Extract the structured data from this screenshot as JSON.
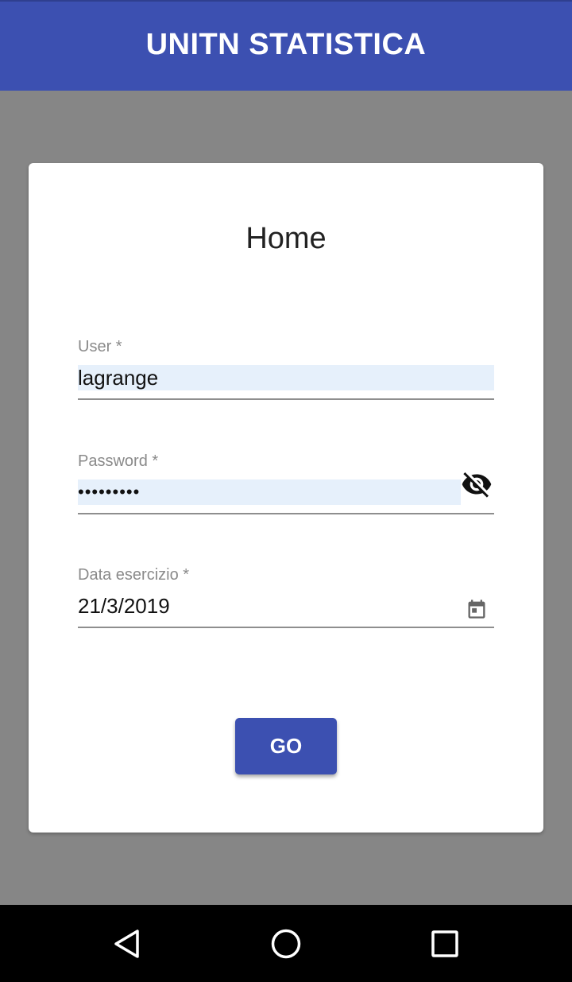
{
  "appbar": {
    "title": "UNITN STATISTICA"
  },
  "card": {
    "title": "Home",
    "user": {
      "label": "User *",
      "value": "lagrange"
    },
    "password": {
      "label": "Password *",
      "value": "•••••••••",
      "toggle_icon": "visibility-off-icon"
    },
    "date": {
      "label": "Data esercizio *",
      "value": "21/3/2019",
      "picker_icon": "calendar-icon"
    },
    "go_label": "GO"
  },
  "navbar": {
    "back_icon": "back-triangle-icon",
    "home_icon": "home-circle-icon",
    "recents_icon": "recents-square-icon"
  },
  "colors": {
    "primary": "#3c50b1",
    "background": "#868686",
    "autofill": "#e6f0fb"
  }
}
